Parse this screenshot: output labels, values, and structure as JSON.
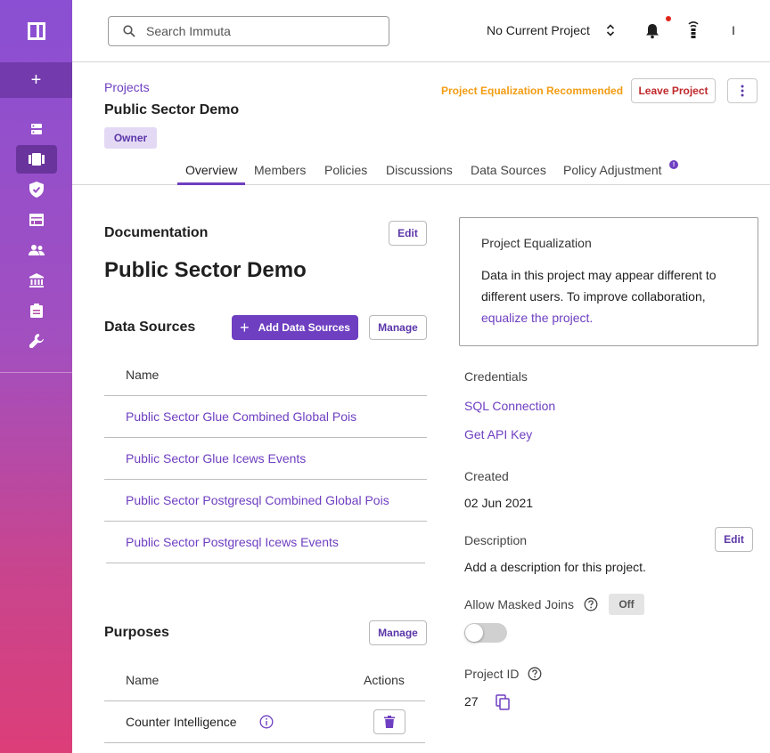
{
  "topbar": {
    "search_placeholder": "Search Immuta",
    "project_selector": "No Current Project",
    "user_initial": "I"
  },
  "header": {
    "breadcrumb": "Projects",
    "title": "Public Sector Demo",
    "role_badge": "Owner",
    "equalization_notice": "Project Equalization Recommended",
    "leave_button": "Leave Project"
  },
  "tabs": [
    {
      "label": "Overview",
      "active": true
    },
    {
      "label": "Members"
    },
    {
      "label": "Policies"
    },
    {
      "label": "Discussions"
    },
    {
      "label": "Data Sources"
    },
    {
      "label": "Policy Adjustment"
    }
  ],
  "documentation": {
    "heading": "Documentation",
    "edit_label": "Edit",
    "doc_title": "Public Sector Demo"
  },
  "data_sources": {
    "heading": "Data Sources",
    "add_label": "Add Data Sources",
    "manage_label": "Manage",
    "column_name": "Name",
    "items": [
      "Public Sector Glue Combined Global Pois",
      "Public Sector Glue Icews Events",
      "Public Sector Postgresql Combined Global Pois",
      "Public Sector Postgresql Icews Events"
    ]
  },
  "purposes": {
    "heading": "Purposes",
    "manage_label": "Manage",
    "column_name": "Name",
    "column_actions": "Actions",
    "items": [
      "Counter Intelligence"
    ]
  },
  "equalization_card": {
    "title": "Project Equalization",
    "text": "Data in this project may appear different to different users. To improve collaboration,",
    "link": "equalize the project."
  },
  "details": {
    "credentials_label": "Credentials",
    "sql_connection": "SQL Connection",
    "api_key": "Get API Key",
    "created_label": "Created",
    "created_value": "02 Jun 2021",
    "description_label": "Description",
    "description_edit": "Edit",
    "description_value": "Add a description for this project.",
    "masked_joins_label": "Allow Masked Joins",
    "masked_joins_state": "Off",
    "project_id_label": "Project ID",
    "project_id_value": "27"
  },
  "colors": {
    "accent": "#6f3fc1",
    "warning": "#f39c12",
    "danger": "#c0282b",
    "badge_bg": "#e3d9f4"
  }
}
